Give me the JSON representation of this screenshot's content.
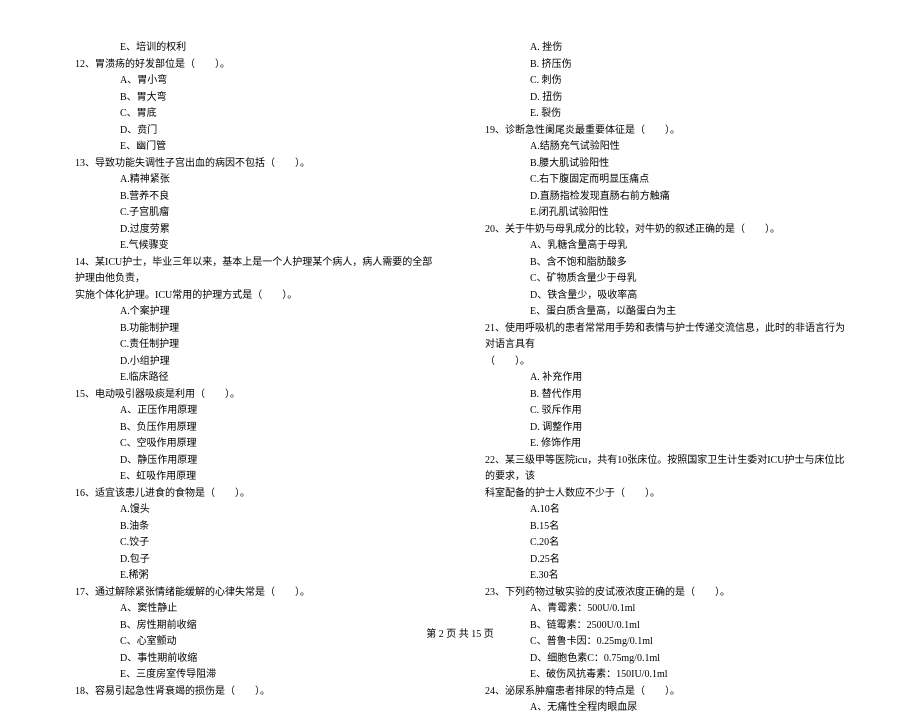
{
  "left_column": [
    {
      "type": "option",
      "text": "E、培训的权利"
    },
    {
      "type": "question",
      "text": "12、胃溃疡的好发部位是（　　）。"
    },
    {
      "type": "option",
      "text": "A、胃小弯"
    },
    {
      "type": "option",
      "text": "B、胃大弯"
    },
    {
      "type": "option",
      "text": "C、胃底"
    },
    {
      "type": "option",
      "text": "D、贲门"
    },
    {
      "type": "option",
      "text": "E、幽门管"
    },
    {
      "type": "question",
      "text": "13、导致功能失调性子宫出血的病因不包括（　　）。"
    },
    {
      "type": "option",
      "text": "A.精神紧张"
    },
    {
      "type": "option",
      "text": "B.营养不良"
    },
    {
      "type": "option",
      "text": "C.子宫肌瘤"
    },
    {
      "type": "option",
      "text": "D.过度劳累"
    },
    {
      "type": "option",
      "text": "E.气候骤变"
    },
    {
      "type": "question",
      "text": "14、某ICU护士，毕业三年以来，基本上是一个人护理某个病人，病人需要的全部护理由他负责，"
    },
    {
      "type": "question-cont",
      "text": "实施个体化护理。ICU常用的护理方式是（　　）。"
    },
    {
      "type": "option",
      "text": "A.个案护理"
    },
    {
      "type": "option",
      "text": "B.功能制护理"
    },
    {
      "type": "option",
      "text": "C.责任制护理"
    },
    {
      "type": "option",
      "text": "D.小组护理"
    },
    {
      "type": "option",
      "text": "E.临床路径"
    },
    {
      "type": "question",
      "text": "15、电动吸引器吸痰是利用（　　）。"
    },
    {
      "type": "option",
      "text": "A、正压作用原理"
    },
    {
      "type": "option",
      "text": "B、负压作用原理"
    },
    {
      "type": "option",
      "text": "C、空吸作用原理"
    },
    {
      "type": "option",
      "text": "D、静压作用原理"
    },
    {
      "type": "option",
      "text": "E、虹吸作用原理"
    },
    {
      "type": "question",
      "text": "16、适宜该患儿进食的食物是（　　）。"
    },
    {
      "type": "option",
      "text": "A.馒头"
    },
    {
      "type": "option",
      "text": "B.油条"
    },
    {
      "type": "option",
      "text": "C.饺子"
    },
    {
      "type": "option",
      "text": "D.包子"
    },
    {
      "type": "option",
      "text": "E.稀粥"
    },
    {
      "type": "question",
      "text": "17、通过解除紧张情绪能缓解的心律失常是（　　）。"
    },
    {
      "type": "option",
      "text": "A、窦性静止"
    },
    {
      "type": "option",
      "text": "B、房性期前收缩"
    },
    {
      "type": "option",
      "text": "C、心室颤动"
    },
    {
      "type": "option",
      "text": "D、事性期前收缩"
    },
    {
      "type": "option",
      "text": "E、三度房室传导阻滞"
    },
    {
      "type": "question",
      "text": "18、容易引起急性肾衰竭的损伤是（　　）。"
    }
  ],
  "right_column": [
    {
      "type": "option",
      "text": "A. 挫伤"
    },
    {
      "type": "option",
      "text": "B. 挤压伤"
    },
    {
      "type": "option",
      "text": "C. 刺伤"
    },
    {
      "type": "option",
      "text": "D. 扭伤"
    },
    {
      "type": "option",
      "text": "E. 裂伤"
    },
    {
      "type": "question",
      "text": "19、诊断急性阑尾炎最重要体征是（　　）。"
    },
    {
      "type": "option",
      "text": "A.结肠充气试验阳性"
    },
    {
      "type": "option",
      "text": "B.腰大肌试验阳性"
    },
    {
      "type": "option",
      "text": "C.右下腹固定而明显压痛点"
    },
    {
      "type": "option",
      "text": "D.直肠指检发现直肠右前方触痛"
    },
    {
      "type": "option",
      "text": "E.闭孔肌试验阳性"
    },
    {
      "type": "question",
      "text": "20、关于牛奶与母乳成分的比较，对牛奶的叙述正确的是（　　）。"
    },
    {
      "type": "option",
      "text": "A、乳糖含量高于母乳"
    },
    {
      "type": "option",
      "text": "B、含不饱和脂肪酸多"
    },
    {
      "type": "option",
      "text": "C、矿物质含量少于母乳"
    },
    {
      "type": "option",
      "text": "D、铁含量少，吸收率高"
    },
    {
      "type": "option",
      "text": "E、蛋白质含量高，以酪蛋白为主"
    },
    {
      "type": "question",
      "text": "21、使用呼吸机的患者常常用手势和表情与护士传递交流信息，此时的非语言行为对语言具有"
    },
    {
      "type": "question-cont",
      "text": "（　　）。"
    },
    {
      "type": "option",
      "text": "A. 补充作用"
    },
    {
      "type": "option",
      "text": "B. 替代作用"
    },
    {
      "type": "option",
      "text": "C. 驳斥作用"
    },
    {
      "type": "option",
      "text": "D. 调整作用"
    },
    {
      "type": "option",
      "text": "E. 修饰作用"
    },
    {
      "type": "question",
      "text": "22、某三级甲等医院icu，共有10张床位。按照国家卫生计生委对ICU护士与床位比的要求，该"
    },
    {
      "type": "question-cont",
      "text": "科室配备的护士人数应不少于（　　）。"
    },
    {
      "type": "option",
      "text": "A.10名"
    },
    {
      "type": "option",
      "text": "B.15名"
    },
    {
      "type": "option",
      "text": "C.20名"
    },
    {
      "type": "option",
      "text": "D.25名"
    },
    {
      "type": "option",
      "text": "E.30名"
    },
    {
      "type": "question",
      "text": "23、下列药物过敏实验的皮试液浓度正确的是（　　）。"
    },
    {
      "type": "option",
      "text": "A、青霉素：500U/0.1ml"
    },
    {
      "type": "option",
      "text": "B、链霉素：2500U/0.1ml"
    },
    {
      "type": "option",
      "text": "C、普鲁卡因：0.25mg/0.1ml"
    },
    {
      "type": "option",
      "text": "D、细胞色素C：0.75mg/0.1ml"
    },
    {
      "type": "option",
      "text": "E、破伤风抗毒素：150IU/0.1ml"
    },
    {
      "type": "question",
      "text": "24、泌尿系肿瘤患者排尿的特点是（　　）。"
    },
    {
      "type": "option",
      "text": "A、无痛性全程肉眼血尿"
    }
  ],
  "footer": "第 2 页 共 15 页"
}
